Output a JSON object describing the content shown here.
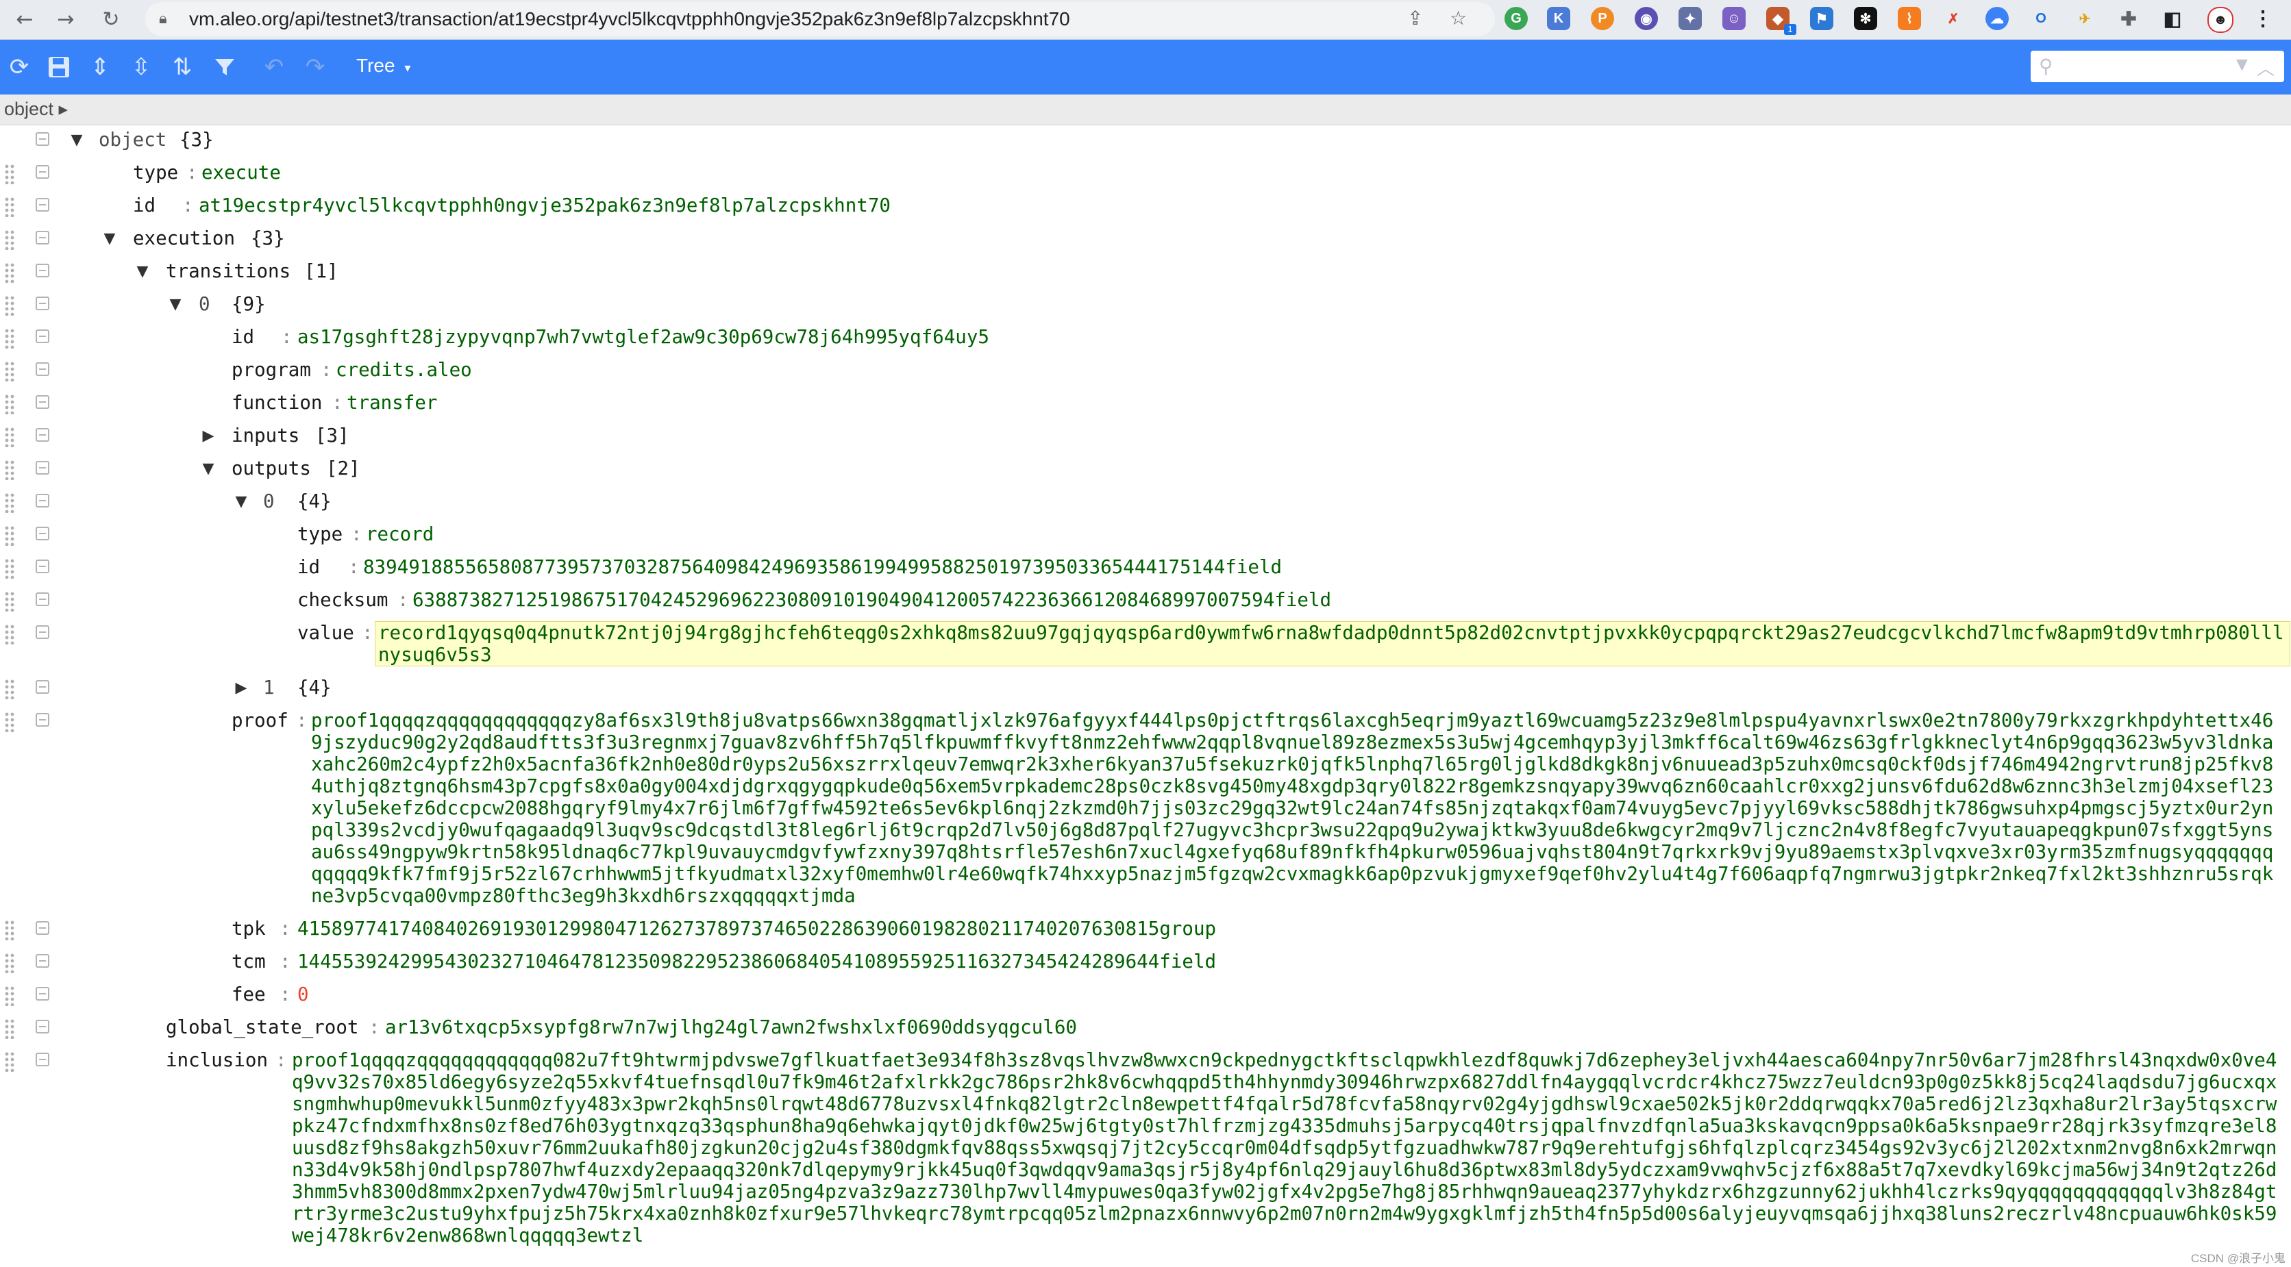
{
  "browser": {
    "url": "vm.aleo.org/api/testnet3/transaction/at19ecstpr4yvcl5lkcqvtpphh0ngvje352pak6z3n9ef8lp7alzcpskhnt70",
    "extension_badge": "1"
  },
  "menu": {
    "mode_label": "Tree",
    "mode_caret": "▾",
    "search_placeholder": ""
  },
  "navbar": {
    "breadcrumb": "object ▸"
  },
  "tree": {
    "root": {
      "key": "object",
      "count": "{3}"
    },
    "type": {
      "key": "type",
      "value": "execute"
    },
    "id": {
      "key": "id",
      "value": "at19ecstpr4yvcl5lkcqvtpphh0ngvje352pak6z3n9ef8lp7alzcpskhnt70"
    },
    "execution": {
      "key": "execution",
      "count": "{3}",
      "transitions": {
        "key": "transitions",
        "count": "[1]",
        "item0": {
          "key": "0",
          "count": "{9}",
          "id": {
            "key": "id",
            "value": "as17gsghft28jzypyvqnp7wh7vwtglef2aw9c30p69cw78j64h995yqf64uy5"
          },
          "program": {
            "key": "program",
            "value": "credits.aleo"
          },
          "function": {
            "key": "function",
            "value": "transfer"
          },
          "inputs": {
            "key": "inputs",
            "count": "[3]"
          },
          "outputs": {
            "key": "outputs",
            "count": "[2]",
            "out0": {
              "key": "0",
              "count": "{4}",
              "type": {
                "key": "type",
                "value": "record"
              },
              "id": {
                "key": "id",
                "value": "8394918855658087739573703287564098424969358619949958825019739503365444175144field"
              },
              "checksum": {
                "key": "checksum",
                "value": "6388738271251986751704245296962230809101904904120057422363661208468997007594field"
              },
              "value": {
                "key": "value",
                "value": "record1qyqsq0q4pnutk72ntj0j94rg8gjhcfeh6teqg0s2xhkq8ms82uu97gqjqyqsp6ard0ywmfw6rna8wfdadp0dnnt5p82d02cnvtptjpvxkk0ycpqpqrckt29as27eudcgcvlkchd7lmcfw8apm9td9vtmhrp080lllnysuq6v5s3"
              }
            },
            "out1": {
              "key": "1",
              "count": "{4}"
            }
          },
          "proof": {
            "key": "proof",
            "value": "proof1qqqqzqqqqqqqqqqqqzy8af6sx3l9th8ju8vatps66wxn38gqmatljxlzk976afgyyxf444lps0pjctftrqs6laxcgh5eqrjm9yaztl69wcuamg5z23z9e8lmlpspu4yavnxrlswx0e2tn7800y79rkxzgrkhpdyhtettx469jszyduc90g2y2qd8audftts3f3u3regnmxj7guav8zv6hff5h7q5lfkpuwmffkvyft8nmz2ehfwww2qqpl8vqnuel89z8ezmex5s3u5wj4gcemhqyp3yjl3mkff6calt69w46zs63gfrlgkkneclyt4n6p9gqq3623w5yv3ldnkaxahc260m2c4ypfz2h0x5acnfa36fk2nh0e80dr0yps2u56xszrrxlqeuv7emwqr2k3xher6kyan37u5fsekuzrk0jqfk5lnphq7l65rg0ljglkd8dkgk8njv6nuuead3p5zuhx0mcsq0ckf0dsjf746m4942ngrvtrun8jp25fkv84uthjq8ztgnq6hsm43p7cpgfs8x0a0gy004xdjdgrxqgygqpkude0q56xem5vrpkademc28ps0czk8svg450my48xgdp3qry0l822r8gemkzsnqyapy39wvq6zn60caahlcr0xxg2junsv6fdu62d8w6znnc3h3elzmj04xsefl23xylu5ekefz6dccpcw2088hgqryf9lmy4x7r6jlm6f7gffw4592te6s5ev6kpl6nqj2zkzmd0h7jjs03zc29gq32wt9lc24an74fs85njzqtakqxf0am74vuyg5evc7pjyyl69vksc588dhjtk786gwsuhxp4pmgscj5yztx0ur2ynpql339s2vcdjy0wufqagaadq9l3uqv9sc9dcqstdl3t8leg6rlj6t9crqp2d7lv50j6g8d87pqlf27ugyvc3hcpr3wsu22qpq9u2ywajktkw3yuu8de6kwgcyr2mq9v7ljcznc2n4v8f8egfc7vyutauapeqgkpun07sfxggt5ynsau6ss49ngpyw9krtn58k95ldnaq6c77kpl9uvauycmdgvfywfzxny397q8htsrfle57esh6n7xucl4gxefyq68uf89nfkfh4pkurw0596uajvqhst804n9t7qrkxrk9vj9yu89aemstx3plvqxve3xr03yrm35zmfnugsyqqqqqqqqqqqq9kfk7fmf9j5r52zl67crhhwwm5jtfkyudmatxl32xyf0memhw0lr4e60wqfk74hxxyp5nazjm5fgzqw2cvxmagkk6ap0pzvukjgmyxef9qef0hv2ylu4t4g7f606aqpfq7ngmrwu3jgtpkr2nkeq7fxl2kt3shhznru5srqkne3vp5cvqa00vmpz80fthc3eg9h3kxdh6rszxqqqqqxtjmda"
          },
          "tpk": {
            "key": "tpk",
            "value": "4158977417408402691930129980471262737897374650228639060198280211740207630815group"
          },
          "tcm": {
            "key": "tcm",
            "value": "1445539242995430232710464781235098229523860684054108955925116327345424289644field"
          },
          "fee": {
            "key": "fee",
            "value": "0"
          }
        }
      },
      "global_state_root": {
        "key": "global_state_root",
        "value": "ar13v6txqcp5xsypfg8rw7n7wjlhg24gl7awn2fwshxlxf0690ddsyqgcul60"
      },
      "inclusion": {
        "key": "inclusion",
        "value": "proof1qqqqzqqqqqqqqqqqq082u7ft9htwrmjpdvswe7gflkuatfaet3e934f8h3sz8vqslhvzw8wwxcn9ckpednygctkftsclqpwkhlezdf8quwkj7d6zephey3eljvxh44aesca604npy7nr50v6ar7jm28fhrsl43nqxdw0x0ve4q9vv32s70x85ld6egy6syze2q55xkvf4tuefnsqdl0u7fk9m46t2afxlrkk2gc786psr2hk8v6cwhqqpd5th4hhynmdy30946hrwzpx6827ddlfn4aygqqlvcrdcr4khcz75wzz7euldcn93p0g0z5kk8j5cq24laqdsdu7jg6ucxqxsngmhwhup0mevukkl5unm0zfyy483x3pwr2kqh5ns0lrqwt48d6778uzvsxl4fnkq82lgtr2cln8ewpettf4fqalr5d78fcvfa58nqyrv02g4yjgdhswl9cxae502k5jk0r2ddqrwqqkx70a5red6j2lz3qxha8ur2lr3ay5tqsxcrwpkz47cfndxmfhx8ns0zf8ed76h03ygtnxqzq33qsphun8ha9q6ehwkajqyt0jdkf0w25wj6tgty0st7hlfrzmjzg4335dmuhsj5arpycq40trsjqpalfnvzdfqnla5ua3kskavqcn9ppsa0k6a5ksnpae9rr28qjrk3syfmzqre3el8uusd8zf9hs8akgzh50xuvr76mm2uukafh80jzgkun20cjg2u4sf380dgmkfqv88qss5xwqsqj7jt2cy5ccqr0m04dfsqdp5ytfgzuadhwkw787r9q9erehtufgjs6hfqlzplcqrz3454gs92v3yc6j2l202xtxnm2nvg8n6xk2mrwqnn33d4v9k58hj0ndlpsp7807hwf4uzxdy2epaaqq320nk7dlqepymy9rjkk45uq0f3qwdqqv9ama3qsjr5j8y4pf6nlq29jauyl6hu8d36ptwx83ml8dy5ydczxam9vwqhv5cjzf6x88a5t7q7xevdkyl69kcjma56wj34n9t2qtz26d3hmm5vh8300d8mmx2pxen7ydw470wj5mlrluu94jaz05ng4pzva3z9azz730lhp7wvll4mypuwes0qa3fyw02jgfx4v2pg5e7hg8j85rhhwqn9aueaq2377yhykdzrx6hzgzunny62jukhh4lczrks9qyqqqqqqqqqqqqlv3h8z84gtrtr3yrme3c2ustu9yhxfpujz5h75krx4xa0znh8k0zfxur9e57lhvkeqrc78ymtrpcqq05zlm2pnazx6nnwvy6p2m07n0rn2m4w9ygxgklmfjzh5th4fn5p5d00s6alyjeuyvqmsqa6jjhxq38luns2reczrlv48ncpuauw6hk0sk59wej478kr6v2enw868wnlqqqqq3ewtzl"
      }
    }
  },
  "footer": {
    "watermark": "CSDN @浪子小鬼"
  },
  "colors": {
    "menu_blue": "#3883fa",
    "string_green": "#006000",
    "number_red": "#ee422e",
    "highlight": "#ffffcc"
  }
}
